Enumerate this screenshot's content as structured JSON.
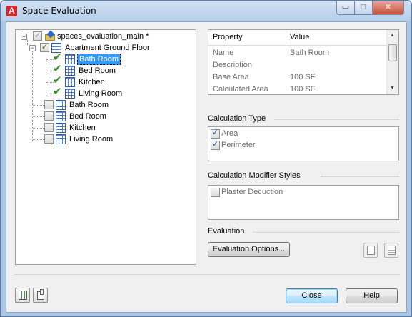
{
  "window": {
    "title": "Space Evaluation",
    "app_icon_glyph": "A",
    "controls": {
      "minimize": "▭",
      "maximize": "□",
      "close": "✕"
    }
  },
  "tree": {
    "root": {
      "label": "spaces_evaluation_main *",
      "checked": true,
      "icon": "drawing-folder-icon"
    },
    "floor": {
      "label": "Apartment Ground Floor",
      "checked": true,
      "icon": "floor-grid-icon"
    },
    "floor_spaces": [
      {
        "label": "Bath Room",
        "checked": true,
        "selected": true
      },
      {
        "label": "Bed Room",
        "checked": true,
        "selected": false
      },
      {
        "label": "Kitchen",
        "checked": true,
        "selected": false
      },
      {
        "label": "Living Room",
        "checked": true,
        "selected": false
      }
    ],
    "unassigned_spaces": [
      {
        "label": "Bath Room",
        "checked": false
      },
      {
        "label": "Bed Room",
        "checked": false
      },
      {
        "label": "Kitchen",
        "checked": false
      },
      {
        "label": "Living Room",
        "checked": false
      }
    ]
  },
  "properties": {
    "headers": {
      "property": "Property",
      "value": "Value"
    },
    "rows": [
      {
        "name": "Name",
        "value": "Bath Room"
      },
      {
        "name": "Description",
        "value": ""
      },
      {
        "name": "Base Area",
        "value": "100  SF"
      },
      {
        "name": "Calculated Area",
        "value": "100  SF"
      }
    ]
  },
  "calculation_type": {
    "title": "Calculation Type",
    "items": [
      {
        "label": "Area",
        "checked": true
      },
      {
        "label": "Perimeter",
        "checked": true
      }
    ]
  },
  "modifier_styles": {
    "title": "Calculation Modifier Styles",
    "items": [
      {
        "label": "Plaster Decuction",
        "checked": false
      }
    ]
  },
  "evaluation": {
    "title": "Evaluation",
    "options_button": "Evaluation Options..."
  },
  "footer": {
    "close_button": "Close",
    "help_button": "Help"
  },
  "colors": {
    "selection": "#3399ff",
    "check_green": "#3a8f1e",
    "title_bar": "#b6cfea",
    "close_button": "#c7503c"
  }
}
